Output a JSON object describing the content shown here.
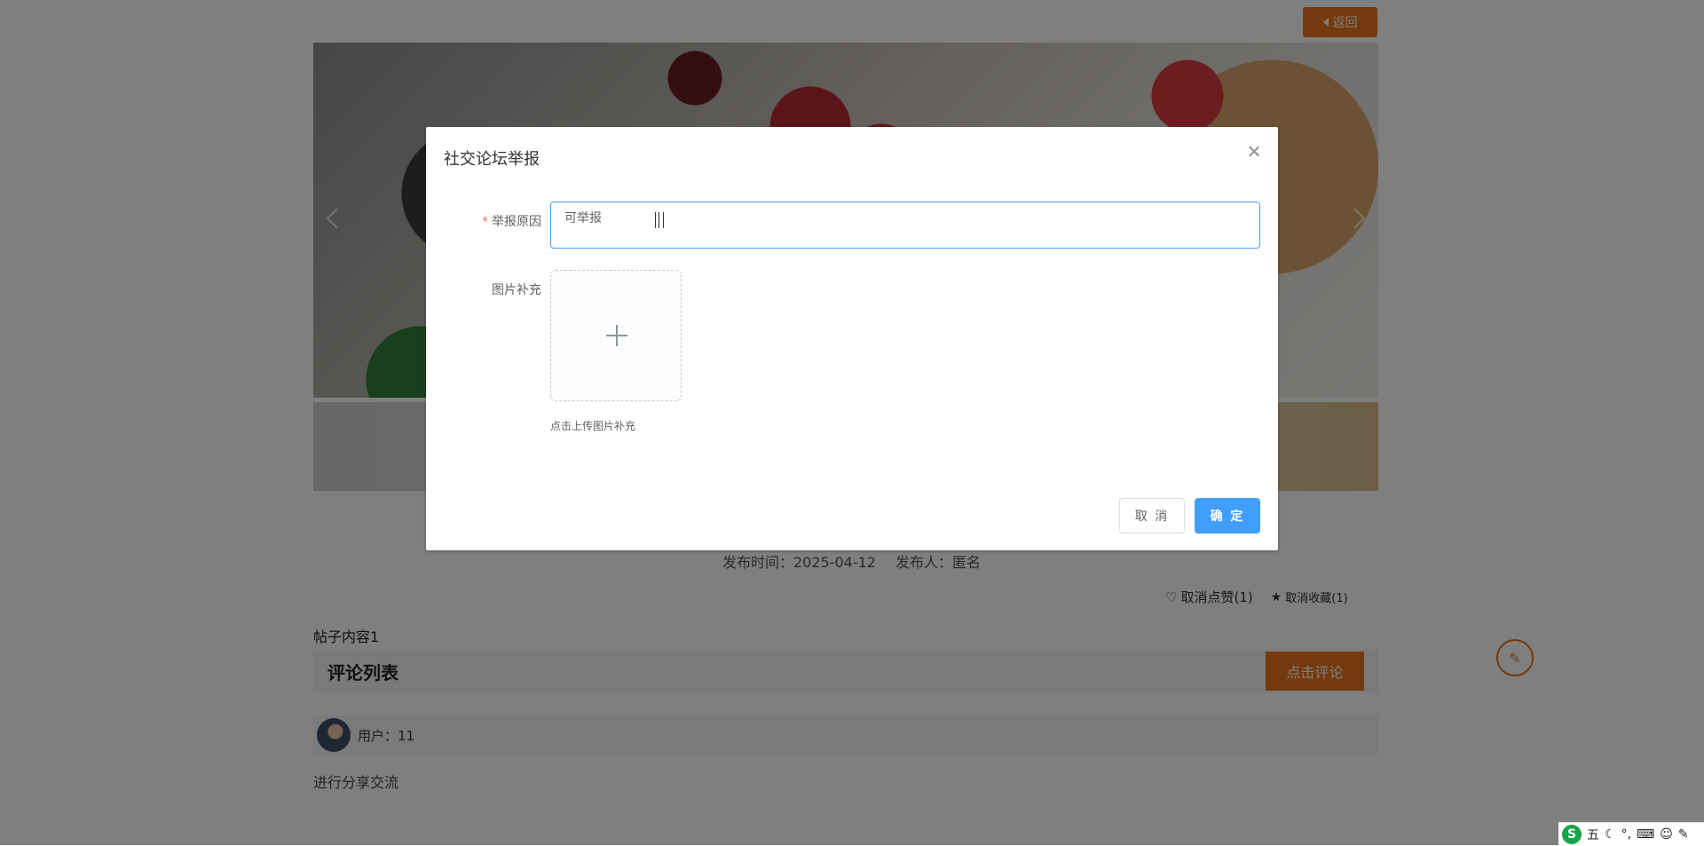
{
  "header": {
    "back_label": "返回"
  },
  "post": {
    "publish_time": "发布时间：2025-04-12",
    "publisher": "发布人：匿名",
    "like_label": "取消点赞(1)",
    "favorite_label": "取消收藏(1)",
    "content": "帖子内容1"
  },
  "comments": {
    "title": "评论列表",
    "add_button": "点击评论",
    "items": [
      {
        "user": "用户：11",
        "text": "进行分享交流"
      }
    ]
  },
  "dialog": {
    "title": "社交论坛举报",
    "reason_label": "举报原因",
    "reason_required_mark": "*",
    "reason_value": "可举报",
    "image_label": "图片补充",
    "upload_tip": "点击上传图片补充",
    "cancel_label": "取 消",
    "confirm_label": "确 定"
  },
  "ime": {
    "mode": "五"
  },
  "colors": {
    "accent": "#e8741b",
    "primary": "#409eff",
    "required": "#f56c6c"
  }
}
